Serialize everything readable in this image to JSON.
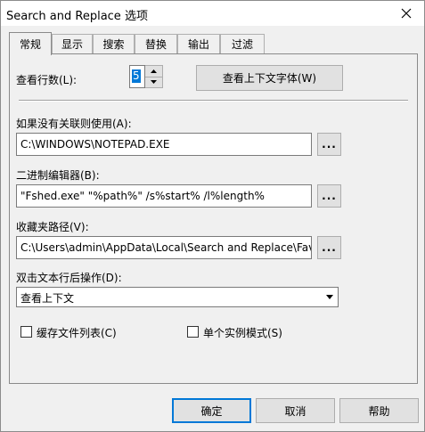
{
  "window": {
    "title": "Search and Replace 选项"
  },
  "tabs": [
    {
      "label": "常规",
      "active": true
    },
    {
      "label": "显示",
      "active": false
    },
    {
      "label": "搜索",
      "active": false
    },
    {
      "label": "替换",
      "active": false
    },
    {
      "label": "输出",
      "active": false
    },
    {
      "label": "过滤",
      "active": false
    }
  ],
  "general": {
    "context_lines_label": "查看行数(L):",
    "context_lines_value": "5",
    "context_font_button": "查看上下文字体(W)",
    "editor_label": "如果没有关联则使用(A):",
    "editor_value": "C:\\WINDOWS\\NOTEPAD.EXE",
    "hex_editor_label": "二进制编辑器(B):",
    "hex_editor_value": "\"Fshed.exe\" \"%path%\" /s%start% /l%length%",
    "favorites_label": "收藏夹路径(V):",
    "favorites_value": "C:\\Users\\admin\\AppData\\Local\\Search and Replace\\Fav",
    "double_click_label": "双击文本行后操作(D):",
    "double_click_value": "查看上下文",
    "cache_files_label": "缓存文件列表(C)",
    "cache_files_checked": false,
    "single_instance_label": "单个实例模式(S)",
    "single_instance_checked": false,
    "browse_label": "..."
  },
  "footer": {
    "ok_label": "确定",
    "cancel_label": "取消",
    "help_label": "帮助"
  }
}
